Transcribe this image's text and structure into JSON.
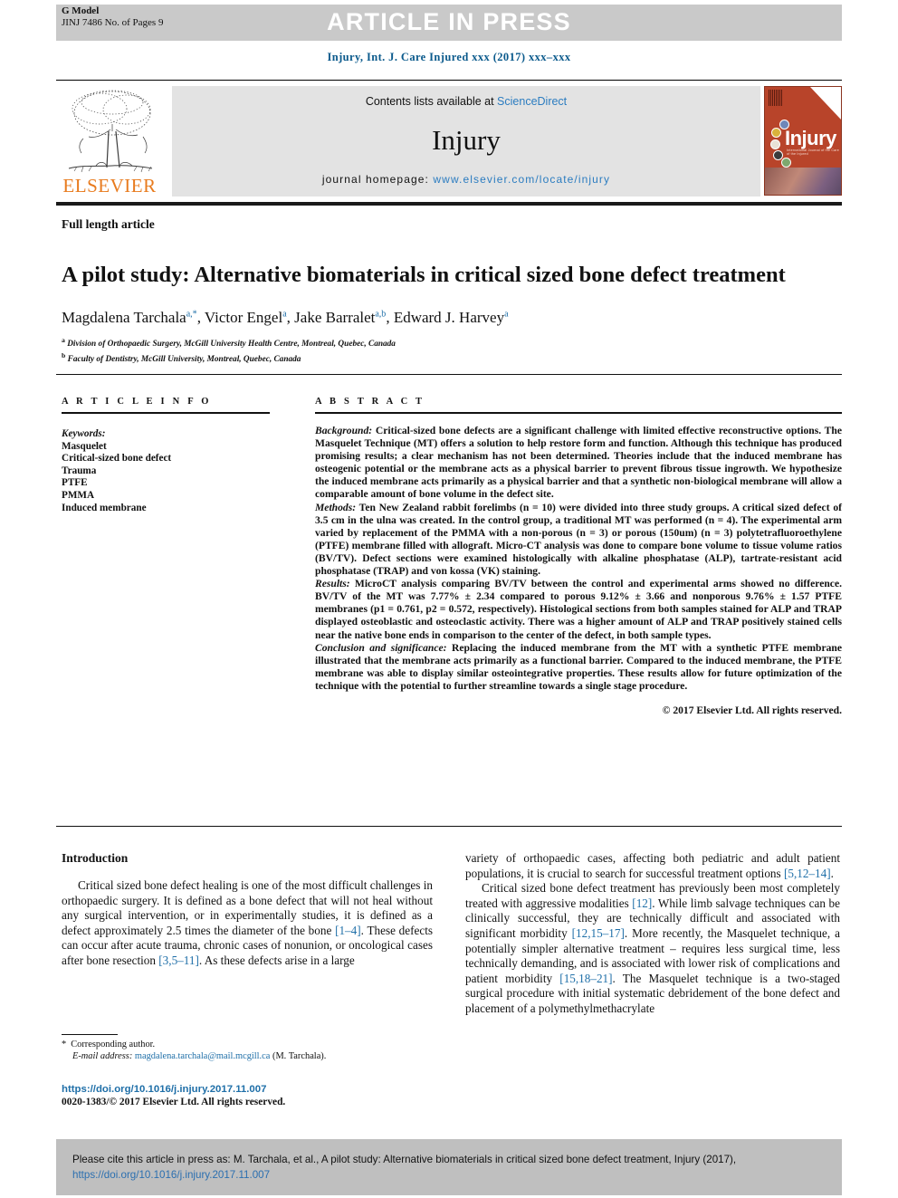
{
  "header": {
    "g_model_line1": "G Model",
    "g_model_line2": "JINJ 7486 No. of Pages 9",
    "banner": "ARTICLE IN PRESS",
    "journal_citation": "Injury, Int. J. Care Injured xxx (2017) xxx–xxx"
  },
  "masthead": {
    "contents_prefix": "Contents lists available at ",
    "sciencedirect": "ScienceDirect",
    "journal_name": "Injury",
    "homepage_label": "journal homepage: ",
    "homepage_url": "www.elsevier.com/locate/injury",
    "publisher": "ELSEVIER",
    "cover_title": "Injury",
    "cover_subtitle": "International Journal of the Care of the Injured",
    "brand_orange": "#e87b1e",
    "cover_red": "#b8442a",
    "link_blue": "#2b7cc0",
    "banner_gray": "#c9c9c9"
  },
  "article": {
    "type": "Full length article",
    "title": "A pilot study: Alternative biomaterials in critical sized bone defect treatment",
    "authors_html": "Magdalena Tarchala<sup>a,*</sup>, Victor Engel<sup>a</sup>, Jake Barralet<sup>a,b</sup>, Edward J. Harvey<sup>a</sup>",
    "affiliation_a": "Division of Orthopaedic Surgery, McGill University Health Centre, Montreal, Quebec, Canada",
    "affiliation_b": "Faculty of Dentistry, McGill University, Montreal, Quebec, Canada"
  },
  "info": {
    "heading": "A R T I C L E  I N F O",
    "keywords_label": "Keywords:",
    "keywords": [
      "Masquelet",
      "Critical-sized bone defect",
      "Trauma",
      "PTFE",
      "PMMA",
      "Induced membrane"
    ]
  },
  "abstract": {
    "heading": "A B S T R A C T",
    "background_label": "Background:",
    "background": " Critical-sized bone defects are a significant challenge with limited effective reconstructive options. The Masquelet Technique (MT) offers a solution to help restore form and function. Although this technique has produced promising results; a clear mechanism has not been determined. Theories include that the induced membrane has osteogenic potential or the membrane acts as a physical barrier to prevent fibrous tissue ingrowth. We hypothesize the induced membrane acts primarily as a physical barrier and that a synthetic non-biological membrane will allow a comparable amount of bone volume in the defect site.",
    "methods_label": "Methods:",
    "methods": " Ten New Zealand rabbit forelimbs (n = 10) were divided into three study groups. A critical sized defect of 3.5 cm in the ulna was created. In the control group, a traditional MT was performed (n = 4). The experimental arm varied by replacement of the PMMA with a non-porous (n = 3) or porous (150um) (n = 3) polytetrafluoroethylene (PTFE) membrane filled with allograft. Micro-CT analysis was done to compare bone volume to tissue volume ratios (BV/TV). Defect sections were examined histologically with alkaline phosphatase (ALP), tartrate-resistant acid phosphatase (TRAP) and von kossa (VK) staining.",
    "results_label": "Results:",
    "results": " MicroCT analysis comparing BV/TV between the control and experimental arms showed no difference. BV/TV of the MT was 7.77% ± 2.34 compared to porous 9.12% ± 3.66 and nonporous 9.76% ± 1.57 PTFE membranes (p1 = 0.761, p2 = 0.572, respectively). Histological sections from both samples stained for ALP and TRAP displayed osteoblastic and osteoclastic activity. There was a higher amount of ALP and TRAP positively stained cells near the native bone ends in comparison to the center of the defect, in both sample types.",
    "conclusion_label": "Conclusion and significance:",
    "conclusion": " Replacing the induced membrane from the MT with a synthetic PTFE membrane illustrated that the membrane acts primarily as a functional barrier. Compared to the induced membrane, the PTFE membrane was able to display similar osteointegrative properties. These results allow for future optimization of the technique with the potential to further streamline towards a single stage procedure.",
    "copyright": "© 2017 Elsevier Ltd. All rights reserved."
  },
  "introduction": {
    "heading": "Introduction",
    "left_p1_a": "Critical sized bone defect healing is one of the most difficult challenges in orthopaedic surgery. It is defined as a bone defect that will not heal without any surgical intervention, or in experimentally studies, it is defined as a defect approximately 2.5 times the diameter of the bone ",
    "left_cite1": "[1–4]",
    "left_p1_b": ". These defects can occur after acute trauma, chronic cases of nonunion, or oncological cases after bone resection ",
    "left_cite2": "[3,5–11]",
    "left_p1_c": ". As these defects arise in a large",
    "right_p1_a": "variety of orthopaedic cases, affecting both pediatric and adult patient populations, it is crucial to search for successful treatment options ",
    "right_cite1": "[5,12–14]",
    "right_p1_b": ".",
    "right_p2_a": "Critical sized bone defect treatment has previously been most completely treated with aggressive modalities ",
    "right_cite2": "[12]",
    "right_p2_b": ". While limb salvage techniques can be clinically successful, they are technically difficult and associated with significant morbidity ",
    "right_cite3": "[12,15–17]",
    "right_p2_c": ". More recently, the Masquelet technique, a potentially simpler alternative treatment – requires less surgical time, less technically demanding, and is associated with lower risk of complications and patient morbidity ",
    "right_cite4": "[15,18–21]",
    "right_p2_d": ". The Masquelet technique is a two-staged surgical procedure with initial systematic debridement of the bone defect and placement of a polymethylmethacrylate"
  },
  "footnotes": {
    "star": "*",
    "corresponding": "Corresponding author.",
    "email_label": "E-mail address:",
    "email": "magdalena.tarchala@mail.mcgill.ca",
    "email_owner": "(M. Tarchala).",
    "doi_url": "https://doi.org/10.1016/j.injury.2017.11.007",
    "issn_line": "0020-1383/© 2017 Elsevier Ltd. All rights reserved."
  },
  "footer": {
    "cite_text": "Please cite this article in press as: M. Tarchala, et al., A pilot study: Alternative biomaterials in critical sized bone defect treatment, Injury (2017),",
    "cite_doi": "https://doi.org/10.1016/j.injury.2017.11.007"
  }
}
